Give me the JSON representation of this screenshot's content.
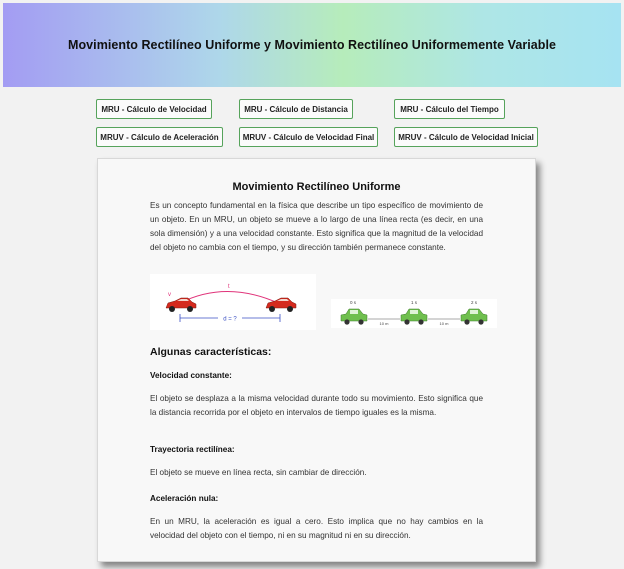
{
  "header": {
    "title": "Movimiento Rectilíneo Uniforme y Movimiento Rectilíneo Uniformemente Variable"
  },
  "nav": {
    "buttons": [
      "MRU - Cálculo de Velocidad",
      "MRU - Cálculo de Distancia",
      "MRU - Cálculo del Tiempo",
      "MRUV - Cálculo de Aceleración",
      "MRUV - Cálculo de Velocidad Final",
      "MRUV - Cálculo de Velocidad Inicial"
    ]
  },
  "content": {
    "title": "Movimiento Rectilíneo Uniforme",
    "intro": "Es un concepto fundamental en la física que describe un tipo específico de movimiento de un objeto. En un MRU, un objeto se mueve a lo largo de una línea recta (es decir, en una sola dimensión) y a una velocidad constante. Esto significa que la magnitud de la velocidad del objeto no cambia con el tiempo, y su dirección también permanece constante.",
    "image1": {
      "label_v": "v",
      "label_t": "t",
      "label_d": "d = ?"
    },
    "image2": {
      "times": [
        "0 s",
        "1 s",
        "2 s"
      ],
      "distances": [
        "10 m",
        "10 m"
      ]
    },
    "characteristics_heading": "Algunas características:",
    "characteristics": [
      {
        "title": "Velocidad constante:",
        "text": "El objeto se desplaza a la misma velocidad durante todo su movimiento. Esto significa que la distancia recorrida por el objeto en intervalos de tiempo iguales es la misma."
      },
      {
        "title": "Trayectoria rectilínea:",
        "text": "El objeto se mueve en línea recta, sin cambiar de dirección."
      },
      {
        "title": "Aceleración nula:",
        "text": "En un MRU, la aceleración es igual a cero. Esto implica que no hay cambios en la velocidad del objeto con el tiempo, ni en su magnitud ni en su dirección."
      }
    ]
  },
  "colors": {
    "button_border": "#56a35b",
    "car_red": "#d42a1e",
    "car_green": "#6fbf4e",
    "arc_pink": "#e0337a",
    "dimension_blue": "#3a4fc4"
  }
}
